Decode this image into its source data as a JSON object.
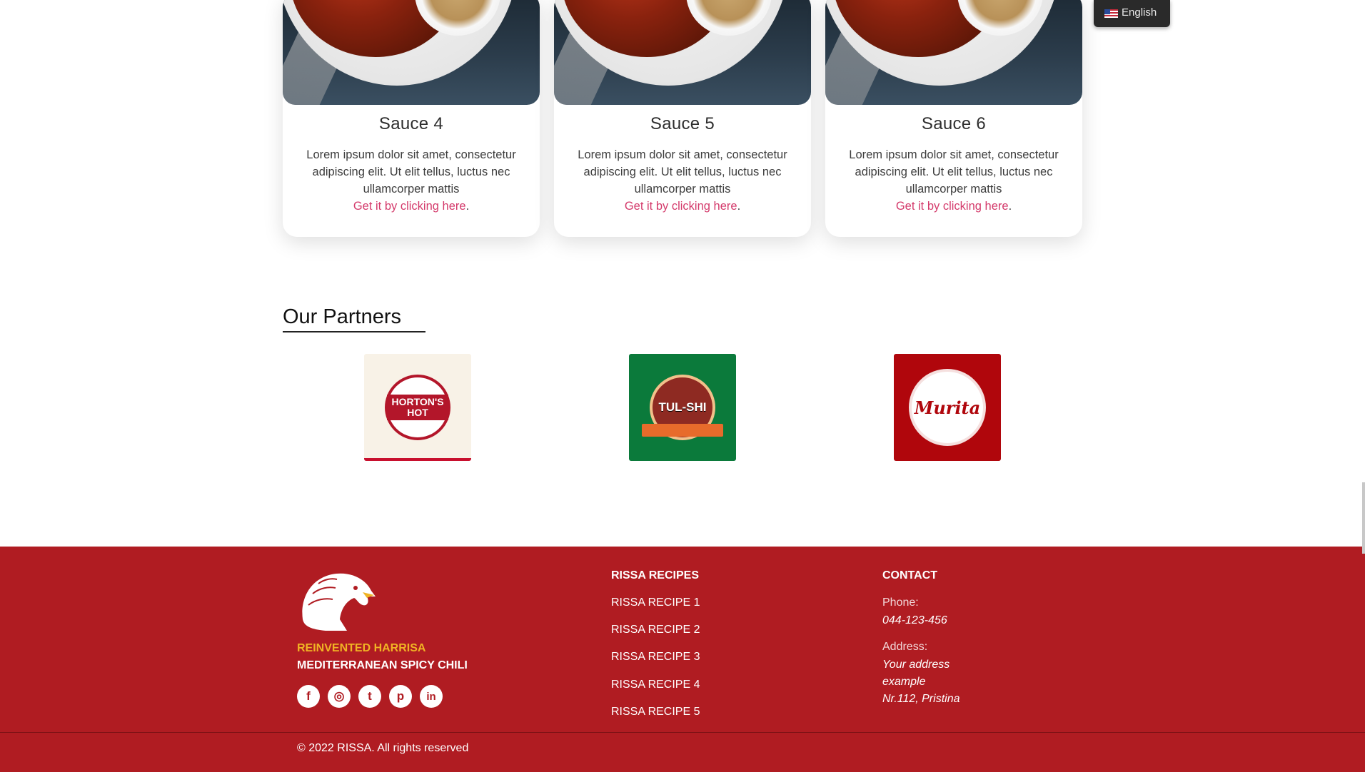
{
  "cards": [
    {
      "title": "Sauce 4",
      "text": "Lorem ipsum dolor sit amet, consectetur adipiscing elit. Ut elit tellus, luctus nec ullamcorper mattis",
      "link": "Get it by clicking here",
      "suffix": "."
    },
    {
      "title": "Sauce 5",
      "text": "Lorem ipsum dolor sit amet, consectetur adipiscing elit. Ut elit tellus, luctus nec ullamcorper mattis",
      "link": "Get it by clicking here",
      "suffix": "."
    },
    {
      "title": "Sauce 6",
      "text": "Lorem ipsum dolor sit amet, consectetur adipiscing elit. Ut elit tellus, luctus nec ullamcorper mattis",
      "link": "Get it by clicking here",
      "suffix": "."
    }
  ],
  "language": {
    "label": "English",
    "flag_icon": "us-flag-icon"
  },
  "partners": {
    "title": "Our Partners",
    "logos": [
      {
        "name": "HORTON'S HOT"
      },
      {
        "name": "TUL-SHI"
      },
      {
        "name": "Murita"
      }
    ]
  },
  "footer": {
    "logo_icon": "eagle-icon",
    "tagline_1": "REINVENTED HARRISA",
    "tagline_2": "MEDITERRANEAN SPICY CHILI",
    "socials": [
      {
        "icon": "facebook-icon",
        "glyph": "f"
      },
      {
        "icon": "instagram-icon",
        "glyph": "◎"
      },
      {
        "icon": "twitter-icon",
        "glyph": "t"
      },
      {
        "icon": "pinterest-icon",
        "glyph": "p"
      },
      {
        "icon": "linkedin-icon",
        "glyph": "in"
      }
    ],
    "recipes_heading": "RISSA RECIPES",
    "recipes": [
      "RISSA RECIPE 1",
      "RISSA RECIPE 2",
      "RISSA RECIPE 3",
      "RISSA RECIPE 4",
      "RISSA RECIPE 5"
    ],
    "contact_heading": "CONTACT",
    "phone_label": "Phone:",
    "phone_value": "044-123-456",
    "address_label": "Address:",
    "address_line1": "Your address",
    "address_line2": "example",
    "address_line3": "Nr.112, Pristina",
    "copyright": "© 2022 RISSA. All rights reserved"
  },
  "colors": {
    "footer_bg": "#b01c22",
    "accent_link": "#d43a6b",
    "tagline_gold": "#f0b324"
  }
}
